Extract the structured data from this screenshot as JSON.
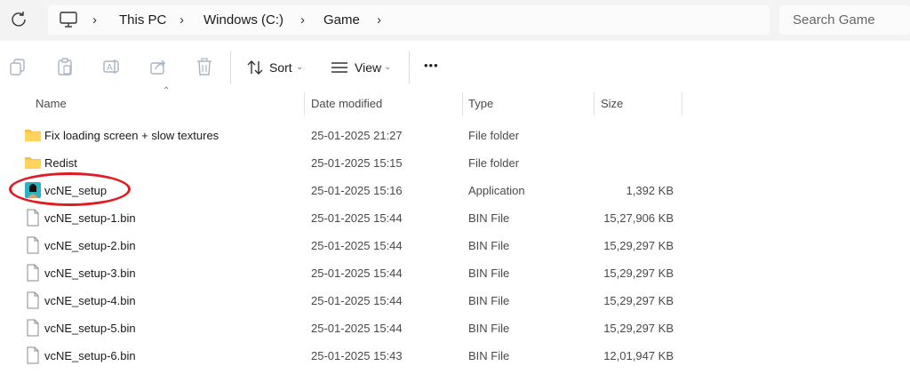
{
  "breadcrumb": {
    "items": [
      "This PC",
      "Windows (C:)",
      "Game"
    ]
  },
  "search": {
    "placeholder": "Search Game"
  },
  "toolbar": {
    "sort_label": "Sort",
    "view_label": "View",
    "more_label": "•••"
  },
  "columns": {
    "name": "Name",
    "date": "Date modified",
    "type": "Type",
    "size": "Size"
  },
  "files": [
    {
      "name": "Fix loading screen + slow textures",
      "date": "25-01-2025 21:27",
      "type": "File folder",
      "size": "",
      "icon": "folder-icon"
    },
    {
      "name": "Redist",
      "date": "25-01-2025 15:15",
      "type": "File folder",
      "size": "",
      "icon": "folder-icon"
    },
    {
      "name": "vcNE_setup",
      "date": "25-01-2025 15:16",
      "type": "Application",
      "size": "1,392 KB",
      "icon": "application-icon"
    },
    {
      "name": "vcNE_setup-1.bin",
      "date": "25-01-2025 15:44",
      "type": "BIN File",
      "size": "15,27,906 KB",
      "icon": "file-icon"
    },
    {
      "name": "vcNE_setup-2.bin",
      "date": "25-01-2025 15:44",
      "type": "BIN File",
      "size": "15,29,297 KB",
      "icon": "file-icon"
    },
    {
      "name": "vcNE_setup-3.bin",
      "date": "25-01-2025 15:44",
      "type": "BIN File",
      "size": "15,29,297 KB",
      "icon": "file-icon"
    },
    {
      "name": "vcNE_setup-4.bin",
      "date": "25-01-2025 15:44",
      "type": "BIN File",
      "size": "15,29,297 KB",
      "icon": "file-icon"
    },
    {
      "name": "vcNE_setup-5.bin",
      "date": "25-01-2025 15:44",
      "type": "BIN File",
      "size": "15,29,297 KB",
      "icon": "file-icon"
    },
    {
      "name": "vcNE_setup-6.bin",
      "date": "25-01-2025 15:43",
      "type": "BIN File",
      "size": "12,01,947 KB",
      "icon": "file-icon"
    }
  ],
  "colors": {
    "folder": "#f5c242",
    "highlight": "#e01b22"
  }
}
